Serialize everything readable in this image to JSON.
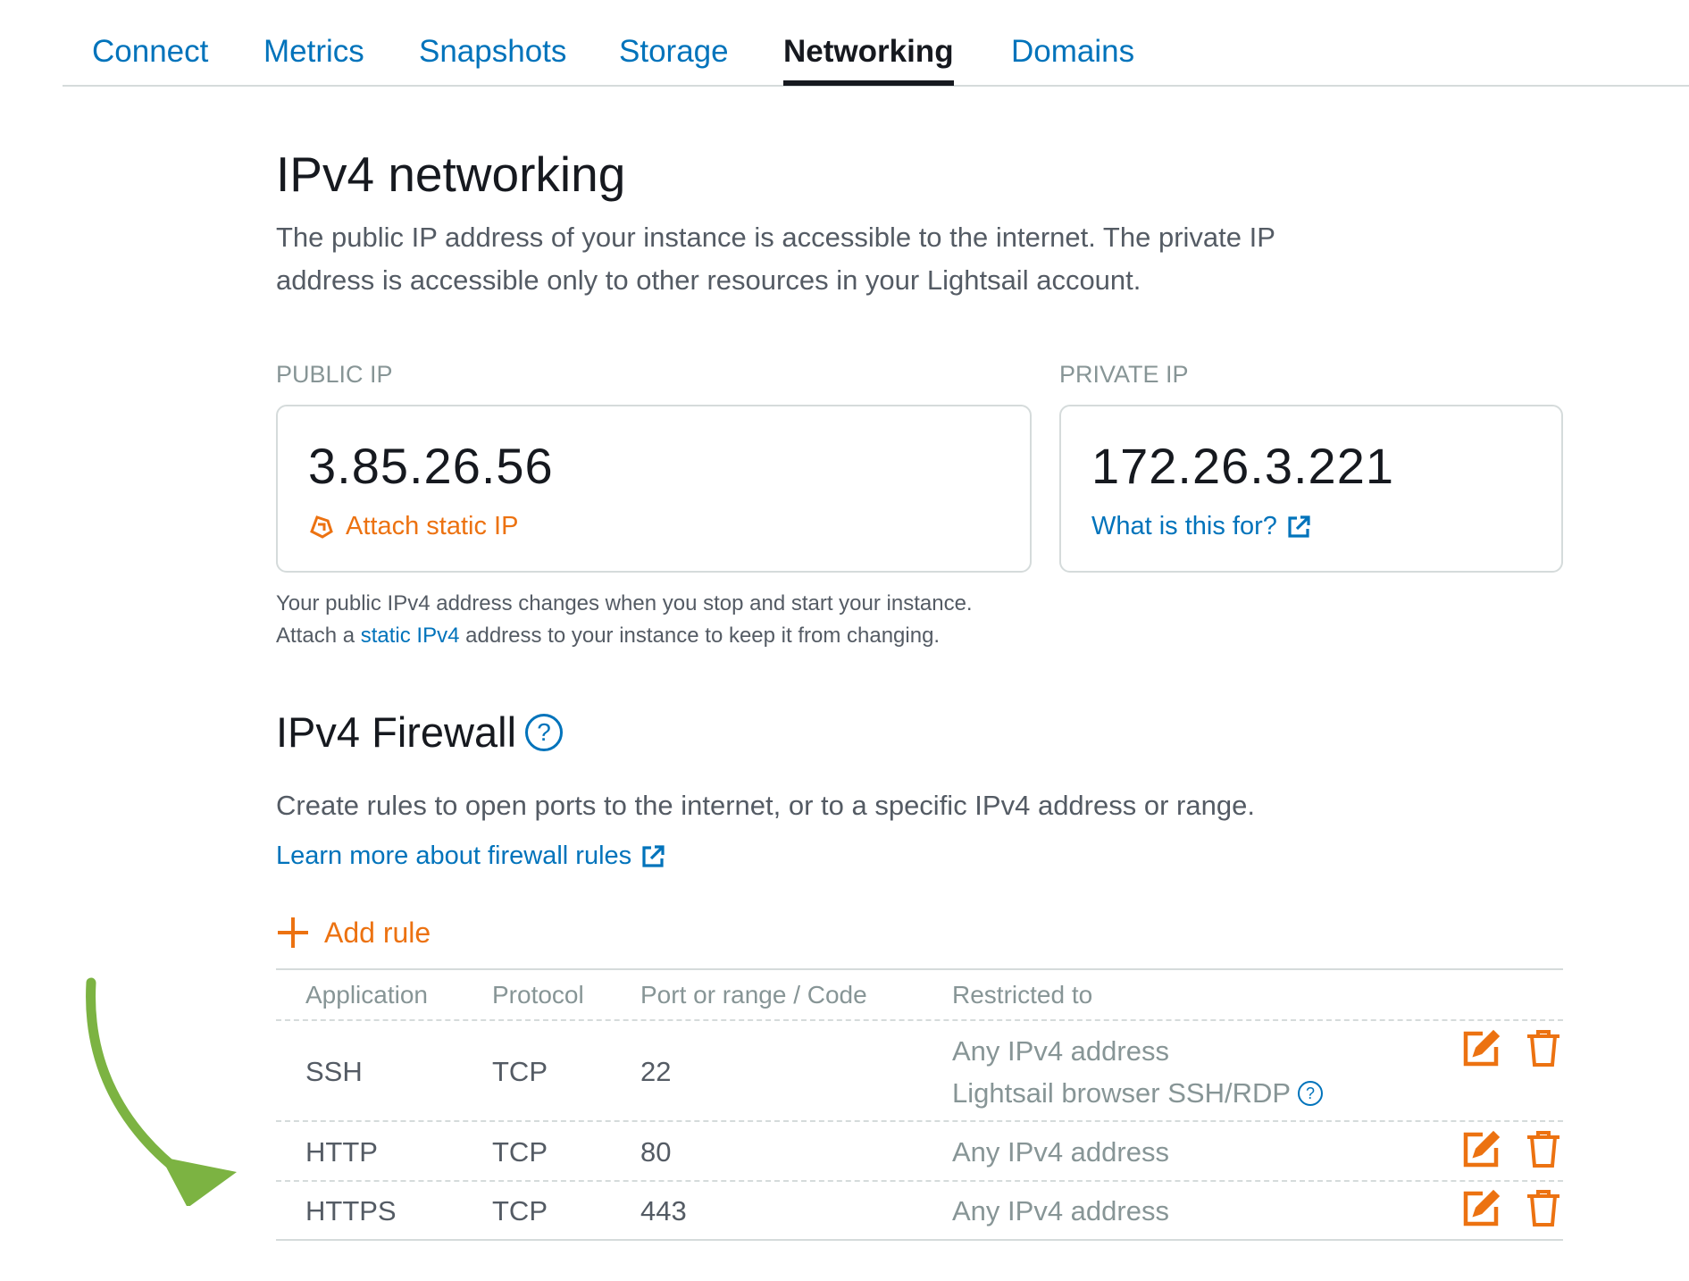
{
  "tabs": [
    {
      "label": "Connect",
      "active": false
    },
    {
      "label": "Metrics",
      "active": false
    },
    {
      "label": "Snapshots",
      "active": false
    },
    {
      "label": "Storage",
      "active": false
    },
    {
      "label": "Networking",
      "active": true
    },
    {
      "label": "Domains",
      "active": false
    }
  ],
  "ipv4": {
    "title": "IPv4 networking",
    "description_line1": "The public IP address of your instance is accessible to the internet. The private IP",
    "description_line2": "address is accessible only to other resources in your Lightsail account.",
    "public": {
      "label": "PUBLIC IP",
      "value": "3.85.26.56",
      "action": "Attach static IP",
      "action_icon": "static-ip-icon"
    },
    "private": {
      "label": "PRIVATE IP",
      "value": "172.26.3.221",
      "link": "What is this for?",
      "link_icon": "external-link-icon"
    },
    "note_line1": "Your public IPv4 address changes when you stop and start your instance.",
    "note_line2_before": "Attach a",
    "note_line2_link": "static IPv4",
    "note_line2_after": "address to your instance to keep it from changing."
  },
  "firewall": {
    "title": "IPv4 Firewall",
    "help_icon": "?",
    "description": "Create rules to open ports to the internet, or to a specific IPv4 address or range.",
    "learn_more": "Learn more about firewall rules",
    "add_rule": "Add rule",
    "columns": [
      "Application",
      "Protocol",
      "Port or range / Code",
      "Restricted to"
    ],
    "rows": [
      {
        "application": "SSH",
        "protocol": "TCP",
        "port": "22",
        "restricted": "Any IPv4 address",
        "restricted_extra": "Lightsail browser SSH/RDP"
      },
      {
        "application": "HTTP",
        "protocol": "TCP",
        "port": "80",
        "restricted": "Any IPv4 address"
      },
      {
        "application": "HTTPS",
        "protocol": "TCP",
        "port": "443",
        "restricted": "Any IPv4 address"
      }
    ]
  },
  "colors": {
    "link": "#0073bb",
    "action": "#ec7211",
    "arrow": "#7cb342",
    "text": "#16191f",
    "muted": "#879596"
  }
}
